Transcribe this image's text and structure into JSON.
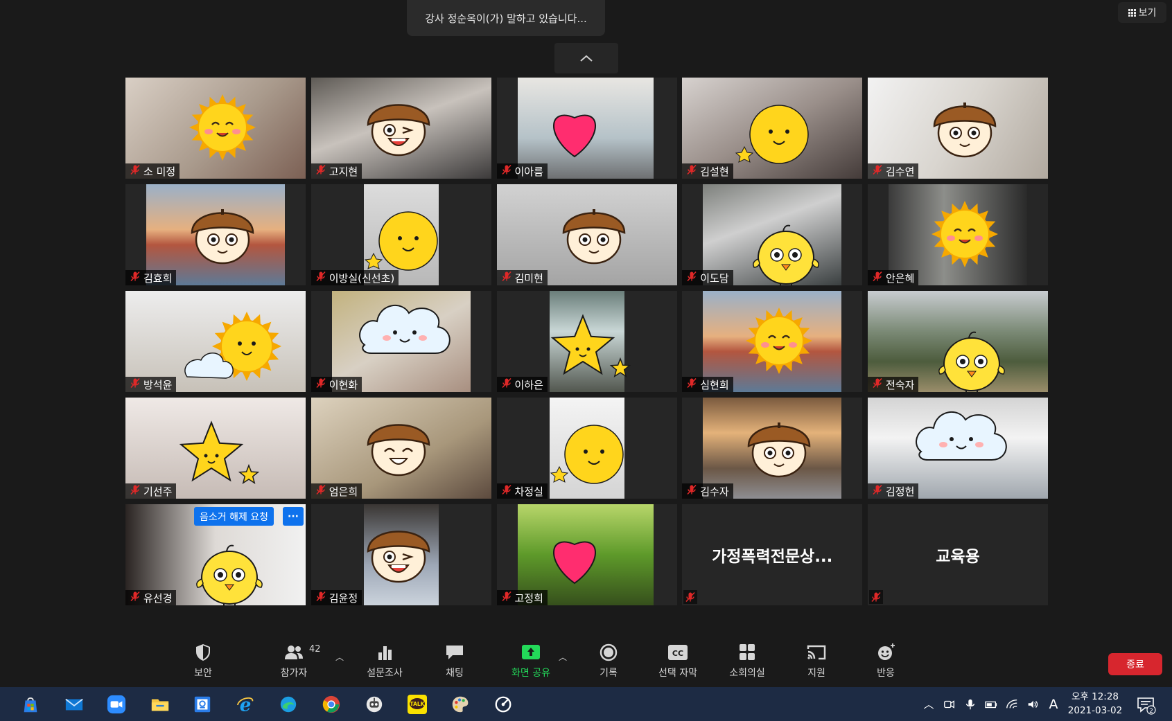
{
  "speaking_banner": "강사 정순옥이(가) 말하고 있습니다...",
  "view_button": "보기",
  "participants": [
    {
      "name": "소 미정",
      "bg": "c1",
      "video": "full",
      "sticker": "sun"
    },
    {
      "name": "고지현",
      "bg": "c2",
      "video": "full",
      "sticker": "acorn-wink"
    },
    {
      "name": "이아름",
      "bg": "c3",
      "video": "mid",
      "sticker": "heart"
    },
    {
      "name": "김설현",
      "bg": "c4",
      "video": "full",
      "sticker": "moon-star"
    },
    {
      "name": "김수연",
      "bg": "c5",
      "video": "full",
      "sticker": "acorn"
    },
    {
      "name": "김효희",
      "bg": "bridge",
      "video": "narrow",
      "sticker": "acorn"
    },
    {
      "name": "이방실(신선초)",
      "bg": "c6",
      "video": "mid2",
      "sticker": "moon-star"
    },
    {
      "name": "김미현",
      "bg": "c7",
      "video": "full",
      "sticker": "acorn"
    },
    {
      "name": "이도담",
      "bg": "c8",
      "video": "narrow",
      "sticker": "chick"
    },
    {
      "name": "안은혜",
      "bg": "c9",
      "video": "narrow",
      "sticker": "sun"
    },
    {
      "name": "방석윤",
      "bg": "c10",
      "video": "full",
      "sticker": "sun-cloud"
    },
    {
      "name": "이현화",
      "bg": "c11",
      "video": "narrow",
      "sticker": "cloud"
    },
    {
      "name": "이하은",
      "bg": "c12",
      "video": "mid2",
      "sticker": "star"
    },
    {
      "name": "심현희",
      "bg": "bridge",
      "video": "narrow",
      "sticker": "sun"
    },
    {
      "name": "전숙자",
      "bg": "mountain",
      "video": "full",
      "sticker": "chick"
    },
    {
      "name": "기선주",
      "bg": "c13",
      "video": "full",
      "sticker": "star"
    },
    {
      "name": "엄은희",
      "bg": "c14",
      "video": "full",
      "sticker": "acorn-smile"
    },
    {
      "name": "차정실",
      "bg": "c15",
      "video": "mid2",
      "sticker": "moon-star"
    },
    {
      "name": "김수자",
      "bg": "cafe",
      "video": "narrow",
      "sticker": "acorn"
    },
    {
      "name": "김정헌",
      "bg": "room",
      "video": "full",
      "sticker": "cloud"
    },
    {
      "name": "유선경",
      "bg": "c16",
      "video": "full",
      "sticker": "chick"
    },
    {
      "name": "김윤정",
      "bg": "c17",
      "video": "mid2",
      "sticker": "acorn-wink"
    },
    {
      "name": "고정희",
      "bg": "grass",
      "video": "mid",
      "sticker": "heart"
    }
  ],
  "text_tiles": [
    "가정폭력전문상...",
    "교육용"
  ],
  "unmute_request_label": "음소거 해제 요청",
  "more_label": "···",
  "toolbar": {
    "security": "보안",
    "participants": "참가자",
    "participant_count": "42",
    "polls": "설문조사",
    "chat": "채팅",
    "share_screen": "화면 공유",
    "record": "기록",
    "closed_caption": "선택 자막",
    "cc_badge": "CC",
    "breakout_rooms": "소회의실",
    "support": "지원",
    "reactions": "반응",
    "end": "종료"
  },
  "colors": {
    "background": "#1a1a1a",
    "tile": "#262626",
    "accent_blue": "#0e72ed",
    "share_green": "#23d959",
    "end_red": "#d7262e",
    "mic_off_red": "#e02828",
    "taskbar": "#1d2b44"
  },
  "taskbar": {
    "kakao_label": "TALK",
    "ime": "A",
    "time": "오후 12:28",
    "date": "2021-03-02",
    "notification_count": "2"
  }
}
